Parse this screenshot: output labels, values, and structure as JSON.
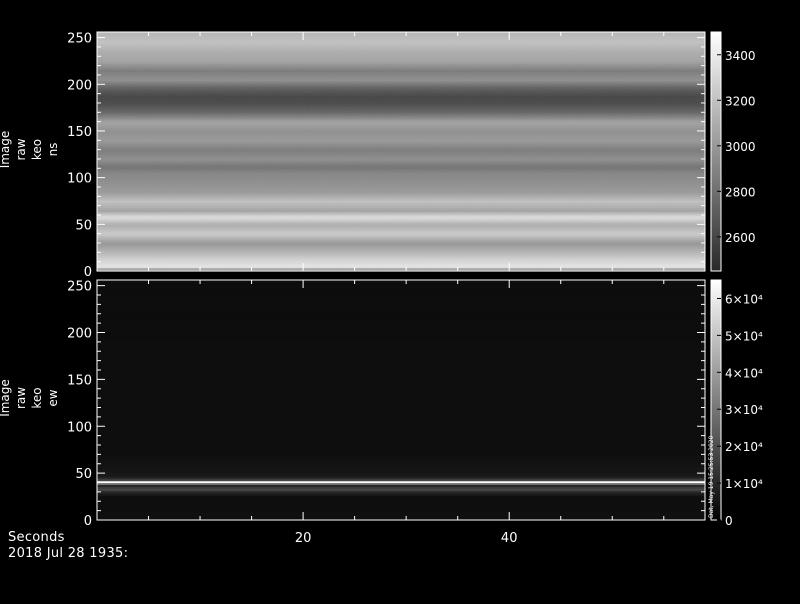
{
  "footer": {
    "xlabel": "Seconds",
    "timestamp": "2018 Jul 28 1935:"
  },
  "side_label": "Dat, May 19 15:25:53 2020",
  "colors": {
    "background": "#000000",
    "text": "#ffffff"
  },
  "chart_data": [
    {
      "type": "heatmap",
      "ylabel_lines": [
        "Image",
        "raw",
        "keo",
        "ns"
      ],
      "xlim": [
        0,
        59
      ],
      "ylim": [
        0,
        256
      ],
      "yticks": [
        0,
        50,
        100,
        150,
        200,
        250
      ],
      "xticks": [
        20,
        40
      ],
      "xtick_labels_shown": false,
      "colorbar": {
        "range": [
          2450,
          3500
        ],
        "ticks": [
          2600,
          2800,
          3000,
          3200,
          3400
        ],
        "tick_labels": [
          "2600",
          "2800",
          "3000",
          "3200",
          "3400"
        ]
      },
      "row_profile": [
        {
          "y": 0,
          "v": 2750
        },
        {
          "y": 5,
          "v": 3380
        },
        {
          "y": 12,
          "v": 3300
        },
        {
          "y": 20,
          "v": 3150
        },
        {
          "y": 30,
          "v": 2980
        },
        {
          "y": 40,
          "v": 3250
        },
        {
          "y": 50,
          "v": 3100
        },
        {
          "y": 58,
          "v": 3350
        },
        {
          "y": 65,
          "v": 3050
        },
        {
          "y": 75,
          "v": 3200
        },
        {
          "y": 85,
          "v": 3000
        },
        {
          "y": 95,
          "v": 2950
        },
        {
          "y": 105,
          "v": 2900
        },
        {
          "y": 112,
          "v": 2800
        },
        {
          "y": 120,
          "v": 2950
        },
        {
          "y": 130,
          "v": 2850
        },
        {
          "y": 140,
          "v": 3000
        },
        {
          "y": 150,
          "v": 2950
        },
        {
          "y": 160,
          "v": 3050
        },
        {
          "y": 170,
          "v": 2750
        },
        {
          "y": 180,
          "v": 2600
        },
        {
          "y": 188,
          "v": 2580
        },
        {
          "y": 196,
          "v": 2700
        },
        {
          "y": 205,
          "v": 2950
        },
        {
          "y": 215,
          "v": 2850
        },
        {
          "y": 225,
          "v": 3050
        },
        {
          "y": 235,
          "v": 3100
        },
        {
          "y": 245,
          "v": 3200
        },
        {
          "y": 256,
          "v": 3150
        }
      ]
    },
    {
      "type": "heatmap",
      "ylabel_lines": [
        "Image",
        "raw",
        "keo",
        "ew"
      ],
      "xlim": [
        0,
        59
      ],
      "ylim": [
        0,
        256
      ],
      "yticks": [
        0,
        50,
        100,
        150,
        200,
        250
      ],
      "xticks": [
        20,
        40
      ],
      "xtick_labels": [
        "20",
        "40"
      ],
      "colorbar": {
        "range": [
          0,
          65000
        ],
        "ticks": [
          0,
          10000,
          20000,
          30000,
          40000,
          50000,
          60000
        ],
        "tick_labels": [
          "0",
          "1×10⁴",
          "2×10⁴",
          "3×10⁴",
          "4×10⁴",
          "5×10⁴",
          "6×10⁴"
        ]
      },
      "row_profile": [
        {
          "y": 0,
          "v": 3500
        },
        {
          "y": 5,
          "v": 4000
        },
        {
          "y": 25,
          "v": 3600
        },
        {
          "y": 30,
          "v": 9000
        },
        {
          "y": 34,
          "v": 22000
        },
        {
          "y": 36,
          "v": 8000
        },
        {
          "y": 38,
          "v": 12000
        },
        {
          "y": 41,
          "v": 64000
        },
        {
          "y": 43,
          "v": 18000
        },
        {
          "y": 46,
          "v": 7000
        },
        {
          "y": 52,
          "v": 5500
        },
        {
          "y": 62,
          "v": 4500
        },
        {
          "y": 75,
          "v": 3700
        },
        {
          "y": 256,
          "v": 3300
        }
      ]
    }
  ]
}
